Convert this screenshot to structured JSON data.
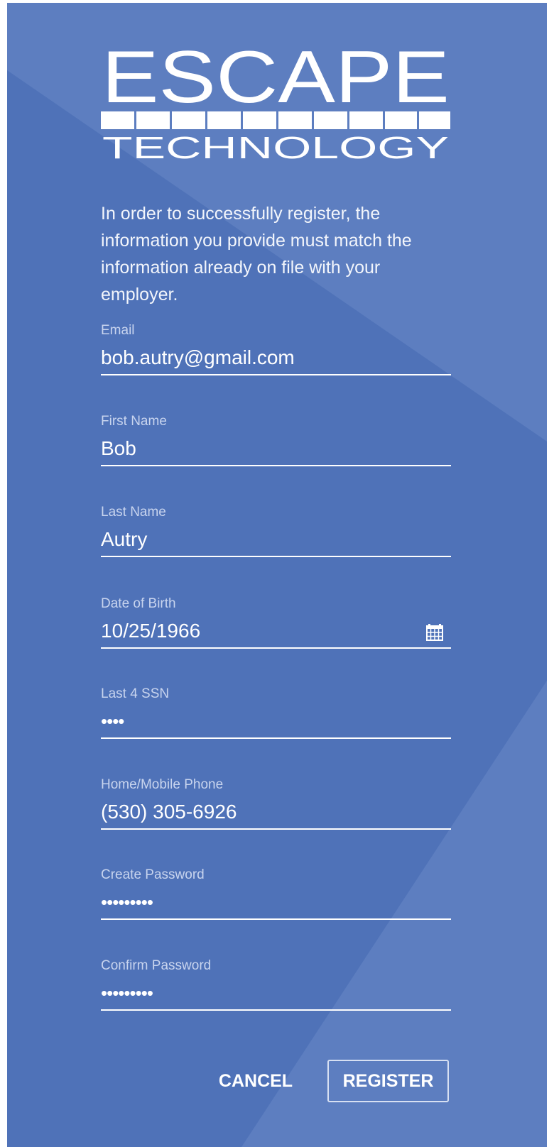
{
  "logo": {
    "word_top": "ESCAPE",
    "word_bottom": "TECHNOLOGY"
  },
  "intro": {
    "text": "In order to successfully register, the information you provide must match the information already on file with your employer."
  },
  "form": {
    "email": {
      "label": "Email",
      "value": "bob.autry@gmail.com"
    },
    "first_name": {
      "label": "First Name",
      "value": "Bob"
    },
    "last_name": {
      "label": "Last Name",
      "value": "Autry"
    },
    "dob": {
      "label": "Date of Birth",
      "value": "10/25/1966",
      "icon": "calendar-icon"
    },
    "ssn": {
      "label": "Last 4 SSN",
      "value": "••••"
    },
    "phone": {
      "label": "Home/Mobile Phone",
      "value": "(530) 305-6926"
    },
    "password": {
      "label": "Create Password",
      "value": "•••••••••"
    },
    "confirm_password": {
      "label": "Confirm Password",
      "value": "•••••••••"
    }
  },
  "actions": {
    "cancel_label": "CANCEL",
    "register_label": "REGISTER"
  },
  "colors": {
    "background": "#4f72b8",
    "background_light": "#6283c3",
    "text": "#ffffff",
    "label": "#c8d4ee"
  }
}
